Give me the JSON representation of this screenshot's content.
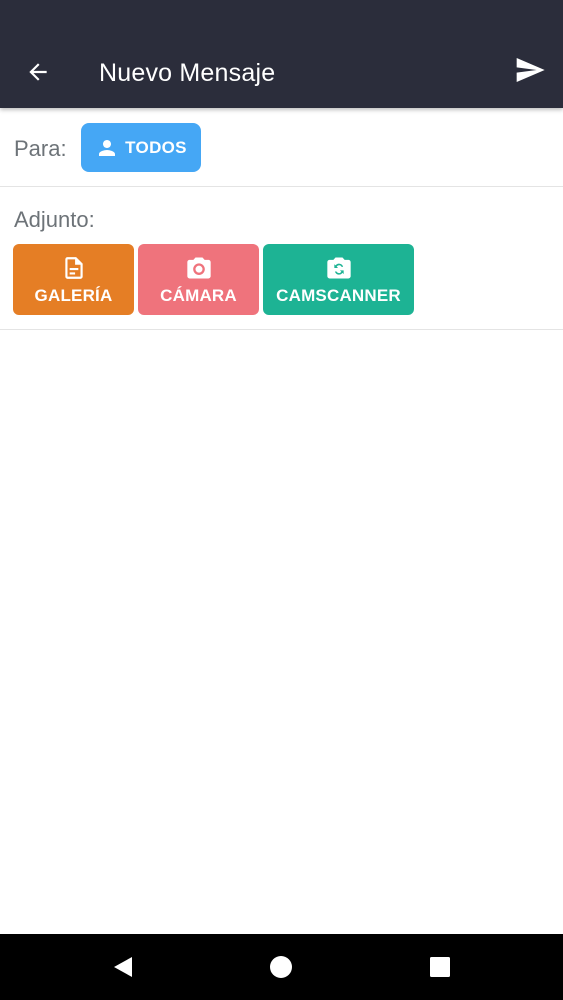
{
  "appbar": {
    "title": "Nuevo Mensaje",
    "back_icon": "arrow-left-icon",
    "send_icon": "send-icon",
    "background": "#2b2d3b"
  },
  "recipient": {
    "label": "Para:",
    "chip_label": "TODOS",
    "chip_icon": "person-icon",
    "chip_color": "#45a7f5"
  },
  "attachments": {
    "label": "Adjunto:",
    "buttons": [
      {
        "label": "GALERÍA",
        "icon": "document-icon",
        "color": "#e57e25"
      },
      {
        "label": "CÁMARA",
        "icon": "camera-icon",
        "color": "#ef737c"
      },
      {
        "label": "CAMSCANNER",
        "icon": "camera-rotate-icon",
        "color": "#1db394"
      }
    ]
  },
  "navbar": {
    "back_icon": "nav-back-icon",
    "home_icon": "nav-home-icon",
    "recent_icon": "nav-recent-icon"
  }
}
